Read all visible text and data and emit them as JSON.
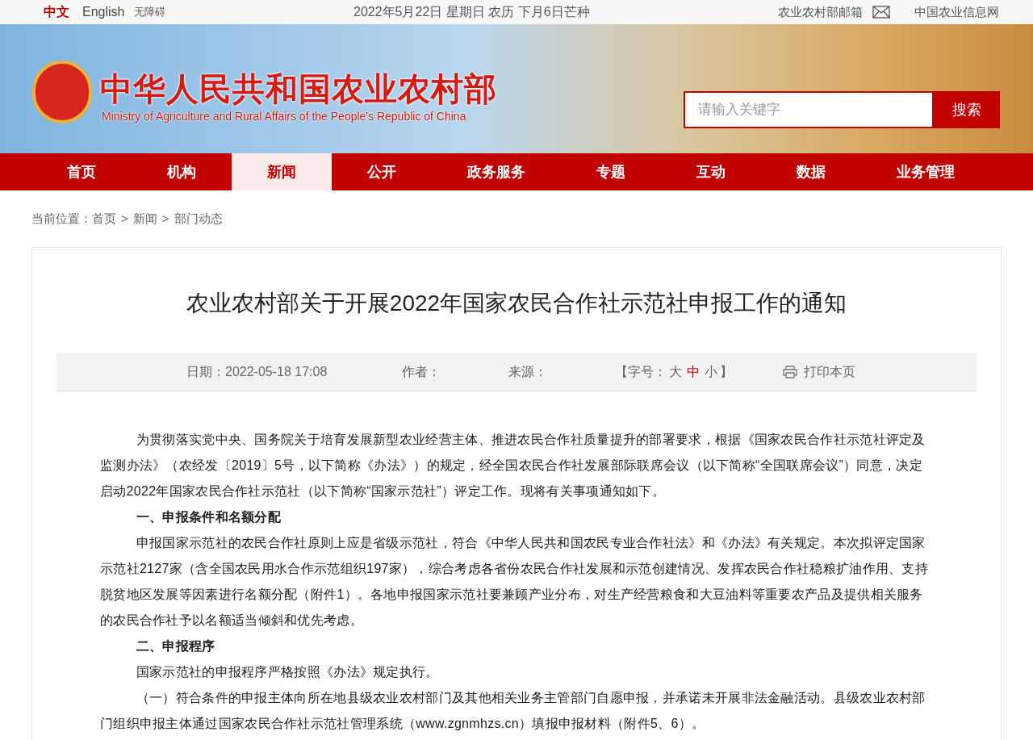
{
  "top_bar": {
    "languages": [
      {
        "label": "中文",
        "selected": true
      },
      {
        "label": "English",
        "selected": false
      }
    ],
    "accessibility": "无障碍",
    "date": "2022年5月22日 星期日 农历 下月6日芒种",
    "mailbox": "农业农村部邮箱",
    "info_net": "中国农业信息网"
  },
  "header": {
    "title": "中华人民共和国农业农村部",
    "subtitle": "Ministry of Agriculture and Rural Affairs of the People's Republic of China",
    "search": {
      "placeholder": "请输入关键字",
      "button": "搜索"
    }
  },
  "nav": [
    {
      "label": "首页",
      "selected": false
    },
    {
      "label": "机构",
      "selected": false
    },
    {
      "label": "新闻",
      "selected": true
    },
    {
      "label": "公开",
      "selected": false
    },
    {
      "label": "政务服务",
      "selected": false
    },
    {
      "label": "专题",
      "selected": false
    },
    {
      "label": "互动",
      "selected": false
    },
    {
      "label": "数据",
      "selected": false
    },
    {
      "label": "业务管理",
      "selected": false
    }
  ],
  "breadcrumb": {
    "label": "当前位置：",
    "items": [
      "首页",
      "新闻",
      "部门动态"
    ],
    "separator": ">"
  },
  "article": {
    "title": "农业农村部关于开展2022年国家农民合作社示范社申报工作的通知",
    "meta": {
      "date": "日期：2022-05-18 17:08",
      "author": "作者：",
      "source": "来源：",
      "font_size": {
        "open": "【字号：",
        "close": "】",
        "options": [
          {
            "label": "大",
            "selected": false
          },
          {
            "label": "中",
            "selected": true
          },
          {
            "label": "小",
            "selected": false
          }
        ]
      },
      "print": "打印本页"
    },
    "paragraphs": [
      {
        "kind": "para",
        "text": "为贯彻落实党中央、国务院关于培育发展新型农业经营主体、推进农民合作社质量提升的部署要求，根据《国家农民合作社示范社评定及监测办法》（农经发〔2019〕5号，以下简称《办法》）的规定，经全国农民合作社发展部际联席会议（以下简称“全国联席会议”）同意，决定启动2022年国家农民合作社示范社（以下简称“国家示范社”）评定工作。现将有关事项通知如下。"
      },
      {
        "kind": "heading",
        "text": "一、申报条件和名额分配"
      },
      {
        "kind": "para",
        "text": "申报国家示范社的农民合作社原则上应是省级示范社，符合《中华人民共和国农民专业合作社法》和《办法》有关规定。本次拟评定国家示范社2127家（含全国农民用水合作示范组织197家），综合考虑各省份农民合作社发展和示范创建情况、发挥农民合作社稳粮扩油作用、支持脱贫地区发展等因素进行名额分配（附件1）。各地申报国家示范社要兼顾产业分布，对生产经营粮食和大豆油料等重要农产品及提供相关服务的农民合作社予以名额适当倾斜和优先考虑。"
      },
      {
        "kind": "heading",
        "text": "二、申报程序"
      },
      {
        "kind": "para",
        "text": "国家示范社的申报程序严格按照《办法》规定执行。"
      },
      {
        "kind": "para",
        "text": "（一）符合条件的申报主体向所在地县级农业农村部门及其他相关业务主管部门自愿申报，并承诺未开展非法金融活动。县级农业农村部门组织申报主体通过国家农民合作社示范社管理系统（www.zgnmhzs.cn）填报申报材料（附件5、6）。"
      }
    ]
  }
}
